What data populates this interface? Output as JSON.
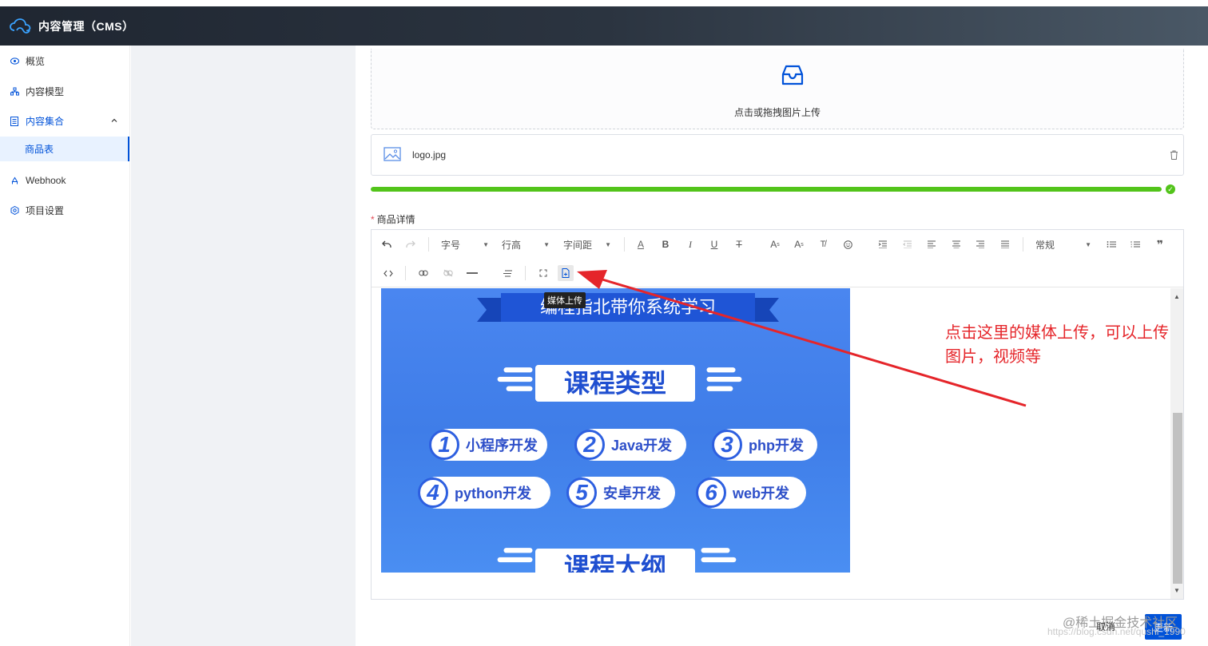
{
  "app": {
    "title": "内容管理（CMS）"
  },
  "sidebar": {
    "items": [
      {
        "label": "概览",
        "icon": "eye-icon"
      },
      {
        "label": "内容模型",
        "icon": "model-icon"
      },
      {
        "label": "内容集合",
        "icon": "collection-icon",
        "expanded": true
      },
      {
        "label": "Webhook",
        "icon": "webhook-icon"
      },
      {
        "label": "项目设置",
        "icon": "settings-icon"
      }
    ],
    "sub_items": [
      {
        "label": "商品表",
        "selected": true
      }
    ]
  },
  "upload": {
    "hint": "点击或拖拽图片上传",
    "file_name": "logo.jpg",
    "progress_percent": 100
  },
  "form": {
    "field_label": "商品详情",
    "required": true
  },
  "toolbar": {
    "font_size": "字号",
    "line_height": "行高",
    "letter_spacing": "字间距",
    "block_format": "常规",
    "tooltip": "媒体上传"
  },
  "banner": {
    "ribbon": "编程指北带你系统学习",
    "heading_top": "课程类型",
    "heading_bottom": "课程大纲",
    "courses": [
      {
        "num": "1",
        "label": "小程序开发"
      },
      {
        "num": "2",
        "label": "Java开发"
      },
      {
        "num": "3",
        "label": "php开发"
      },
      {
        "num": "4",
        "label": "python开发"
      },
      {
        "num": "5",
        "label": "安卓开发"
      },
      {
        "num": "6",
        "label": "web开发"
      }
    ]
  },
  "annotation": {
    "line1": "点击这里的媒体上传，可以上传",
    "line2": "图片，视频等",
    "color": "#e5252a"
  },
  "footer": {
    "cancel": "取消",
    "update": "更新",
    "watermark": "@稀土掘金技术社区",
    "watermark_url": "https://blog.csdn.net/qushi_1990"
  },
  "colors": {
    "primary": "#0052d9",
    "success": "#52c41a",
    "header_bg": "#1f2631"
  }
}
